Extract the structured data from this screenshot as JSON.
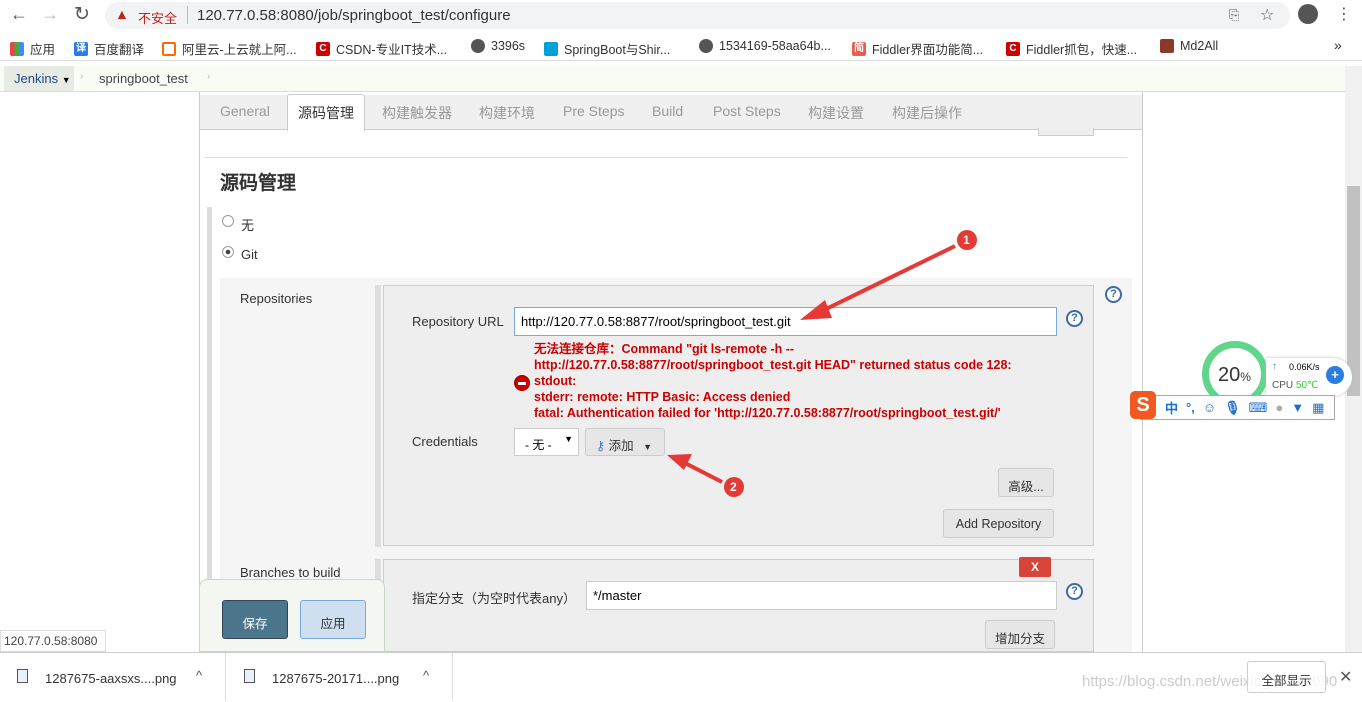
{
  "browser": {
    "url": "120.77.0.58:8080/job/springboot_test/configure",
    "security": "不安全",
    "bookmarks": [
      {
        "label": "应用",
        "color": "#e44"
      },
      {
        "label": "百度翻译",
        "color": "#2a7de1"
      },
      {
        "label": "阿里云-上云就上阿...",
        "color": "#ff6a00"
      },
      {
        "label": "CSDN-专业IT技术...",
        "color": "#c00"
      },
      {
        "label": "3396s",
        "color": "#555"
      },
      {
        "label": "SpringBoot与Shir...",
        "color": "#00a1d6"
      },
      {
        "label": "1534169-58aa64b...",
        "color": "#555"
      },
      {
        "label": "Fiddler界面功能简...",
        "color": "#e8604c"
      },
      {
        "label": "Fiddler抓包，快速...",
        "color": "#c00"
      },
      {
        "label": "Md2All",
        "color": "#8b3a2a"
      }
    ],
    "more": "»",
    "status_url": "120.77.0.58:8080"
  },
  "breadcrumb": {
    "root": "Jenkins",
    "job": "springboot_test"
  },
  "tabs": [
    "General",
    "源码管理",
    "构建触发器",
    "构建环境",
    "Pre Steps",
    "Build",
    "Post Steps",
    "构建设置",
    "构建后操作"
  ],
  "scm": {
    "title": "源码管理",
    "options": [
      {
        "label": "无",
        "selected": false
      },
      {
        "label": "Git",
        "selected": true
      }
    ],
    "repositories_label": "Repositories",
    "repo_url_label": "Repository URL",
    "repo_url": "http://120.77.0.58:8877/root/springboot_test.git",
    "error": [
      "无法连接仓库：Command \"git ls-remote -h --",
      "http://120.77.0.58:8877/root/springboot_test.git HEAD\" returned status code 128:",
      "stdout:",
      "stderr: remote: HTTP Basic: Access denied",
      "fatal: Authentication failed for 'http://120.77.0.58:8877/root/springboot_test.git/'"
    ],
    "credentials_label": "Credentials",
    "credentials_value": "- 无 -",
    "add_label": "添加",
    "advanced": "高级...",
    "add_repository": "Add Repository",
    "branches_label": "Branches to build",
    "branch_spec_label": "指定分支（为空时代表any）",
    "branch_spec": "*/master",
    "add_branch": "增加分支",
    "delete": "X"
  },
  "actions": {
    "save": "保存",
    "apply": "应用"
  },
  "annotations": [
    "1",
    "2"
  ],
  "overlay": {
    "percent": "20",
    "net": "0.06K/s",
    "cpu_label": "CPU",
    "cpu_temp": "50℃",
    "ime": [
      "中",
      "°,"
    ]
  },
  "downloads": {
    "items": [
      "1287675-aaxsxs....png",
      "1287675-20171....png"
    ],
    "show_all": "全部显示",
    "watermark": "https://blog.csdn.net/weixin_43122090"
  },
  "colors": {
    "error": "#cc0000",
    "save": "#4b758b",
    "annot": "#e53935"
  }
}
